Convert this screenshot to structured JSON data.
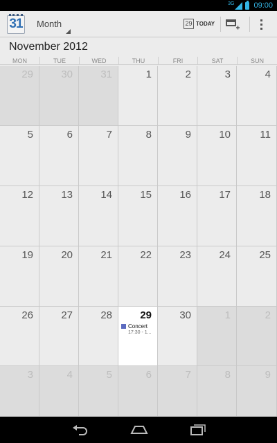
{
  "status_bar": {
    "network": "3G",
    "time": "09:00"
  },
  "app": {
    "icon_day": "31",
    "view_mode": "Month",
    "today_day": "29",
    "today_label": "TODAY"
  },
  "icons": {
    "app": "calendar-app-icon",
    "view_dropdown": "chevron-down-icon",
    "today": "calendar-today-icon",
    "new_event": "new-event-icon",
    "overflow": "overflow-menu-icon",
    "back": "back-icon",
    "home": "home-icon",
    "recents": "recent-apps-icon"
  },
  "month_title": "November 2012",
  "day_names": [
    "MON",
    "TUE",
    "WED",
    "THU",
    "FRI",
    "SAT",
    "SUN"
  ],
  "weeks": [
    [
      {
        "d": "29",
        "out": true
      },
      {
        "d": "30",
        "out": true
      },
      {
        "d": "31",
        "out": true
      },
      {
        "d": "1"
      },
      {
        "d": "2"
      },
      {
        "d": "3"
      },
      {
        "d": "4"
      }
    ],
    [
      {
        "d": "5"
      },
      {
        "d": "6"
      },
      {
        "d": "7"
      },
      {
        "d": "8"
      },
      {
        "d": "9"
      },
      {
        "d": "10"
      },
      {
        "d": "11"
      }
    ],
    [
      {
        "d": "12"
      },
      {
        "d": "13"
      },
      {
        "d": "14"
      },
      {
        "d": "15"
      },
      {
        "d": "16"
      },
      {
        "d": "17"
      },
      {
        "d": "18"
      }
    ],
    [
      {
        "d": "19"
      },
      {
        "d": "20"
      },
      {
        "d": "21"
      },
      {
        "d": "22"
      },
      {
        "d": "23"
      },
      {
        "d": "24"
      },
      {
        "d": "25"
      }
    ],
    [
      {
        "d": "26"
      },
      {
        "d": "27"
      },
      {
        "d": "28"
      },
      {
        "d": "29",
        "today": true,
        "event": {
          "title": "Concert",
          "time": "17:30 - 1..."
        }
      },
      {
        "d": "30"
      },
      {
        "d": "1",
        "out": true
      },
      {
        "d": "2",
        "out": true
      }
    ],
    [
      {
        "d": "3",
        "out": true
      },
      {
        "d": "4",
        "out": true
      },
      {
        "d": "5",
        "out": true
      },
      {
        "d": "6",
        "out": true
      },
      {
        "d": "7",
        "out": true
      },
      {
        "d": "8",
        "out": true
      },
      {
        "d": "9",
        "out": true
      }
    ]
  ],
  "colors": {
    "accent": "#33b5e5",
    "event": "#5c6bc0",
    "today_bg": "#ffffff",
    "out_month_bg": "#dcdcdc"
  }
}
